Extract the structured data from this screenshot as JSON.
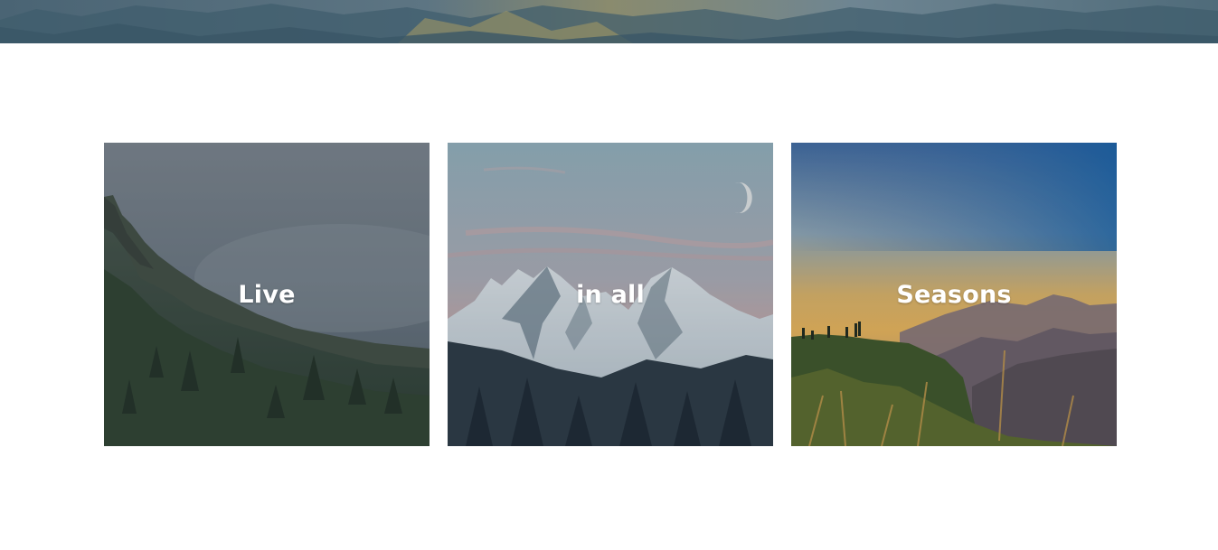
{
  "hero": {
    "image": "mountain-landscape-banner"
  },
  "cards": [
    {
      "title": "Live",
      "image": "misty-forest-mountain"
    },
    {
      "title": "in all",
      "image": "snowy-peaks-moon"
    },
    {
      "title": "Seasons",
      "image": "sunset-hills-hikers"
    }
  ],
  "colors": {
    "background": "#ffffff",
    "title_text": "#ffffff",
    "overlay": "#1e2a38"
  }
}
